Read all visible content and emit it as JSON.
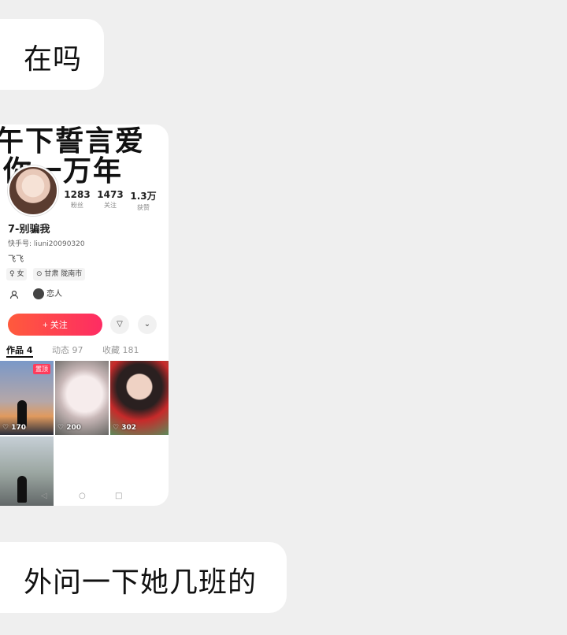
{
  "messages": {
    "first": "在吗",
    "last": "外问一下她几班的"
  },
  "profile": {
    "banner_line1": "午下誓言爱",
    "banner_line2": "你一万年",
    "stats": [
      {
        "num": "1283",
        "label": "粉丝"
      },
      {
        "num": "1473",
        "label": "关注"
      },
      {
        "num": "1.3万",
        "label": "获赞"
      }
    ],
    "username": "7-别骗我",
    "kuaishou_id": "快手号: liuni20090320",
    "bio": "飞飞",
    "tags": {
      "gender": "女",
      "location": "甘肃 陇南市"
    },
    "lover_label": "恋人",
    "follow_label": "+ 关注",
    "tabs": {
      "works": "作品 4",
      "moments": "动态 97",
      "favorites": "收藏 181"
    },
    "thumbs": [
      {
        "likes": "♡ 170",
        "badge": "置顶"
      },
      {
        "likes": "♡ 200"
      },
      {
        "likes": "♡ 302"
      }
    ]
  },
  "icons": {
    "friend": "person-icon",
    "share": "triangle-down-icon",
    "more": "chevron-down-icon"
  },
  "colors": {
    "background": "#efefef",
    "follow_gradient_start": "#ff5a3c",
    "follow_gradient_end": "#fe2c63"
  }
}
